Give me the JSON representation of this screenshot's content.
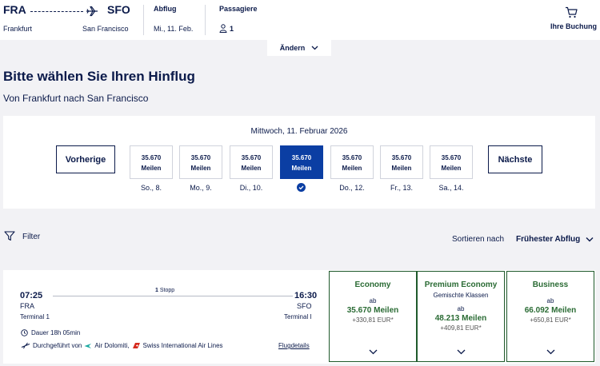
{
  "header": {
    "origin_code": "FRA",
    "origin_city": "Frankfurt",
    "dest_code": "SFO",
    "dest_city": "San Francisco",
    "departure_label": "Abflug",
    "departure_value": "Mi., 11. Feb.",
    "passengers_label": "Passagiere",
    "passengers_value": "1",
    "booking_label": "Ihre Buchung",
    "change_label": "Ändern"
  },
  "page": {
    "title": "Bitte wählen Sie Ihren Hinflug",
    "subtitle": "Von Frankfurt nach San Francisco"
  },
  "dates": {
    "heading": "Mittwoch, 11. Februar 2026",
    "prev_label": "Vorherige",
    "next_label": "Nächste",
    "days": [
      {
        "price": "35.670",
        "unit": "Meilen",
        "label": "So., 8."
      },
      {
        "price": "35.670",
        "unit": "Meilen",
        "label": "Mo., 9."
      },
      {
        "price": "35.670",
        "unit": "Meilen",
        "label": "Di., 10."
      },
      {
        "price": "35.670",
        "unit": "Meilen",
        "label": ""
      },
      {
        "price": "35.670",
        "unit": "Meilen",
        "label": "Do., 12."
      },
      {
        "price": "35.670",
        "unit": "Meilen",
        "label": "Fr., 13."
      },
      {
        "price": "35.670",
        "unit": "Meilen",
        "label": "Sa., 14."
      }
    ]
  },
  "toolbar": {
    "filter_label": "Filter",
    "sort_label": "Sortieren nach",
    "sort_value": "Frühester Abflug"
  },
  "flight": {
    "dep_time": "07:25",
    "dep_airport": "FRA",
    "dep_terminal": "Terminal 1",
    "arr_time": "16:30",
    "arr_airport": "SFO",
    "arr_terminal": "Terminal I",
    "stops_count": "1",
    "stops_word": "Stopp",
    "duration": "Dauer 18h 05min",
    "operated_by": "Durchgeführt von",
    "carrier_1": "Air Dolomiti,",
    "carrier_2": "Swiss International Air Lines",
    "details_link": "Flugdetails",
    "fares": [
      {
        "name": "Economy",
        "sub": "",
        "ab": "ab",
        "miles": "35.670 Meilen",
        "eur": "+330,81 EUR*"
      },
      {
        "name": "Premium Economy",
        "sub": "Gemischte Klassen",
        "ab": "ab",
        "miles": "48.213 Meilen",
        "eur": "+409,81 EUR*"
      },
      {
        "name": "Business",
        "sub": "",
        "ab": "ab",
        "miles": "66.092 Meilen",
        "eur": "+650,81 EUR*"
      }
    ]
  },
  "colors": {
    "brand": "#0b1a4a",
    "selected": "#0b3ea3",
    "fare_green": "#2a6b34",
    "red_logo": "#d52b1e",
    "teal_logo": "#1aa9a0"
  }
}
